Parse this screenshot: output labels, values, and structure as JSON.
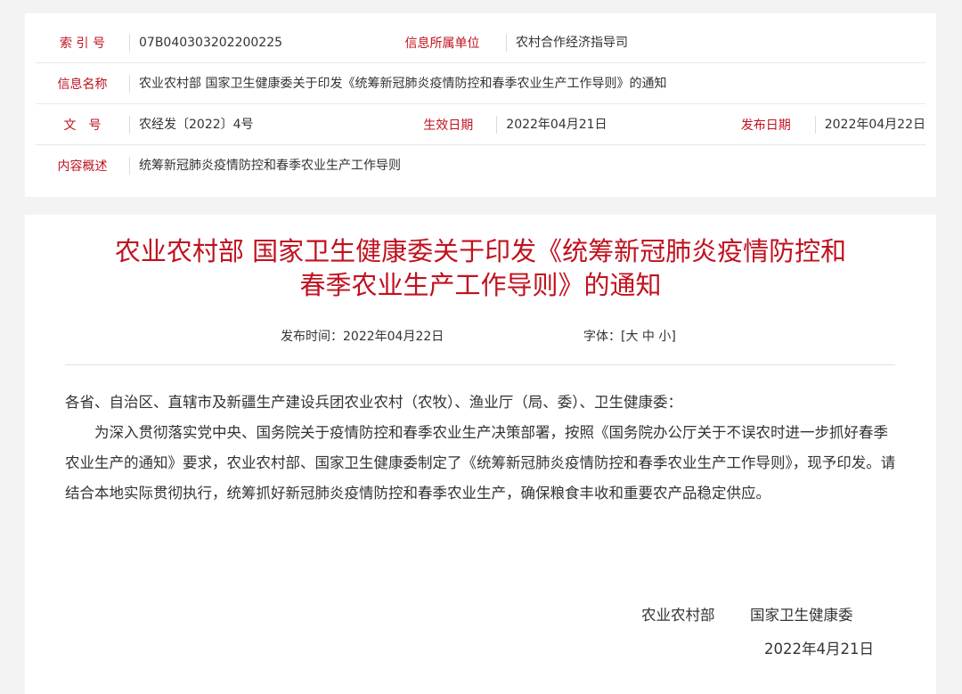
{
  "meta": {
    "index_label": "索 引 号",
    "index_value": "07B040303202200225",
    "unit_label": "信息所属单位",
    "unit_value": "农村合作经济指导司",
    "name_label": "信息名称",
    "name_value": "农业农村部 国家卫生健康委关于印发《统筹新冠肺炎疫情防控和春季农业生产工作导则》的通知",
    "docno_label": "文　号",
    "docno_value": "农经发〔2022〕4号",
    "effective_label": "生效日期",
    "effective_value": "2022年04月21日",
    "publish_label": "发布日期",
    "publish_value": "2022年04月22日",
    "summary_label": "内容概述",
    "summary_value": "统筹新冠肺炎疫情防控和春季农业生产工作导则"
  },
  "article": {
    "title_line1": "农业农村部 国家卫生健康委关于印发《统筹新冠肺炎疫情防控和",
    "title_line2": "春季农业生产工作导则》的通知",
    "publish_time": "发布时间：2022年04月22日",
    "font_label": "字体：[",
    "font_large": "大",
    "font_medium": "中",
    "font_small": "小",
    "font_close": "]",
    "salutation": "各省、自治区、直辖市及新疆生产建设兵团农业农村（农牧）、渔业厅（局、委）、卫生健康委：",
    "paragraph": "为深入贯彻落实党中央、国务院关于疫情防控和春季农业生产决策部署，按照《国务院办公厅关于不误农时进一步抓好春季农业生产的通知》要求，农业农村部、国家卫生健康委制定了《统筹新冠肺炎疫情防控和春季农业生产工作导则》，现予印发。请结合本地实际贯彻执行，统筹抓好新冠肺炎疫情防控和春季农业生产，确保粮食丰收和重要农产品稳定供应。",
    "sign_org1": "农业农村部",
    "sign_org2": "国家卫生健康委",
    "sign_date": "2022年4月21日"
  }
}
